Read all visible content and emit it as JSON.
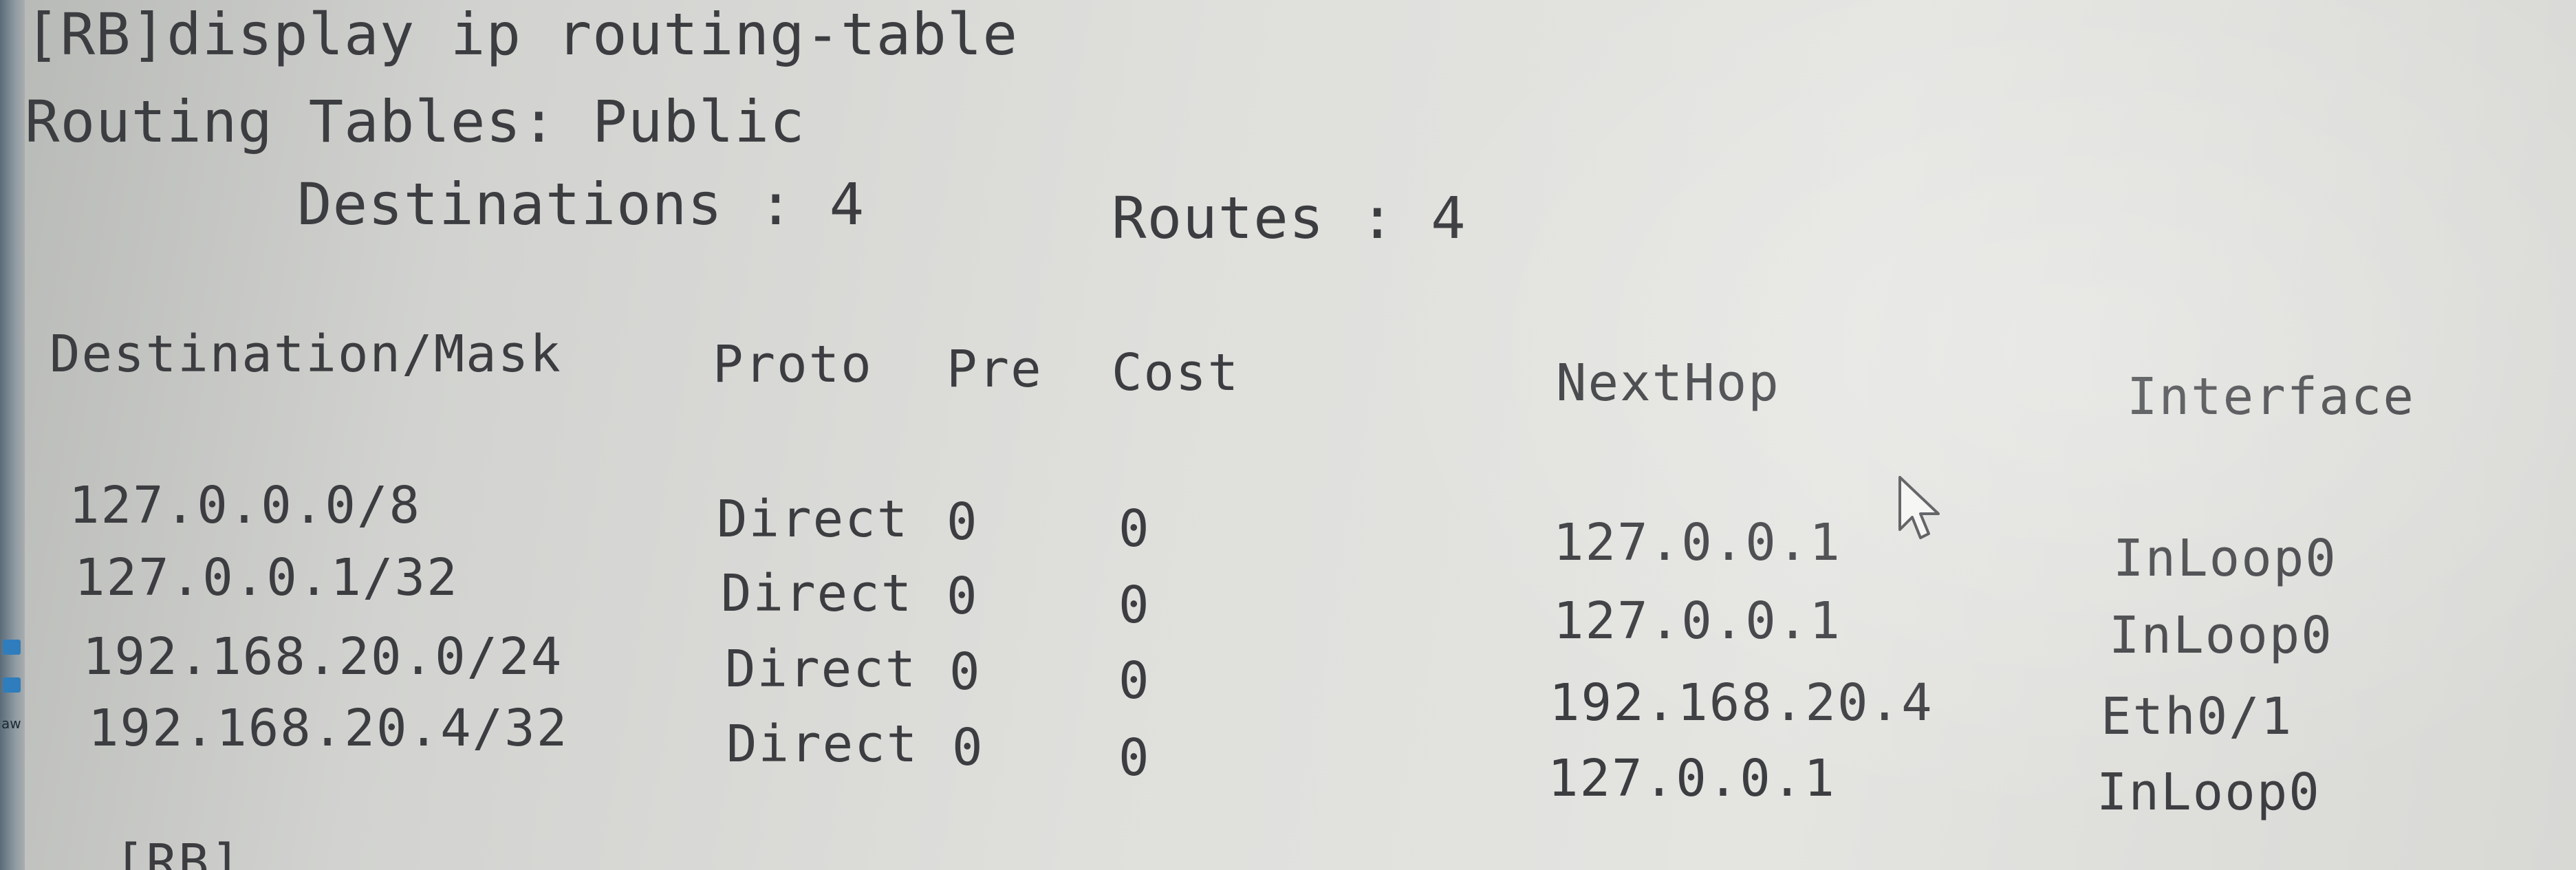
{
  "console": {
    "command_line": "[RB]display ip routing-table",
    "table_title": "Routing Tables: Public",
    "destinations_label": "Destinations : 4",
    "routes_label": "Routes : 4",
    "headers": {
      "destination": "Destination/Mask",
      "proto": "Proto",
      "pre": "Pre",
      "cost": "Cost",
      "nexthop": "NextHop",
      "interface": "Interface"
    },
    "rows": [
      {
        "destination": "127.0.0.0/8",
        "proto": "Direct",
        "pre": "0",
        "cost": "0",
        "nexthop": "127.0.0.1",
        "interface": "InLoop0"
      },
      {
        "destination": "127.0.0.1/32",
        "proto": "Direct",
        "pre": "0",
        "cost": "0",
        "nexthop": "127.0.0.1",
        "interface": "InLoop0"
      },
      {
        "destination": "192.168.20.0/24",
        "proto": "Direct",
        "pre": "0",
        "cost": "0",
        "nexthop": "192.168.20.4",
        "interface": "Eth0/1"
      },
      {
        "destination": "192.168.20.4/32",
        "proto": "Direct",
        "pre": "0",
        "cost": "0",
        "nexthop": "127.0.0.1",
        "interface": "InLoop0"
      }
    ],
    "prompt": "[RB]"
  },
  "left_edge": {
    "label": "aw"
  },
  "colors": {
    "text": "#3b3d40",
    "background": "#e0e0dd",
    "taskbar": "#5a6b78"
  }
}
